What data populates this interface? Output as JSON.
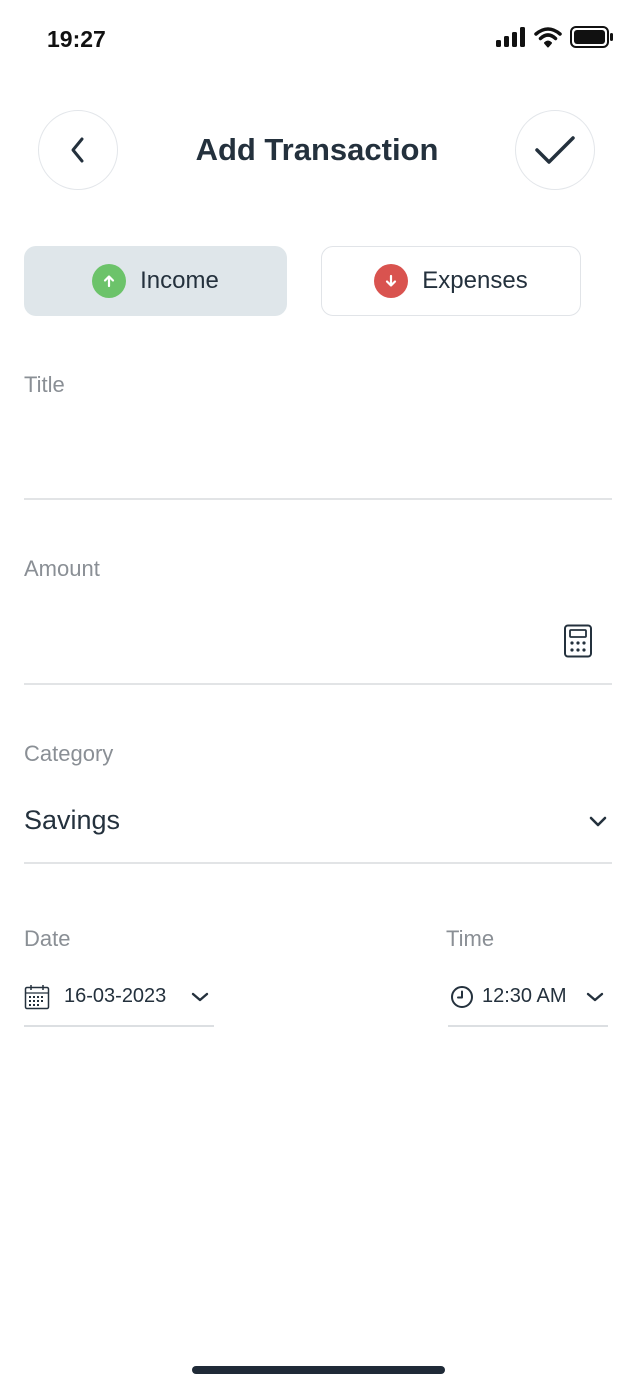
{
  "status_bar": {
    "time": "19:27"
  },
  "header": {
    "title": "Add Transaction"
  },
  "type_toggle": {
    "income_label": "Income",
    "expense_label": "Expenses",
    "income_color": "#6cc36a",
    "expense_color": "#d9534f",
    "selected": "Income"
  },
  "form": {
    "title": {
      "label": "Title",
      "value": ""
    },
    "amount": {
      "label": "Amount",
      "value": ""
    },
    "category": {
      "label": "Category",
      "value": "Savings"
    },
    "date": {
      "label": "Date",
      "value": "16-03-2023"
    },
    "time": {
      "label": "Time",
      "value": "12:30 AM"
    }
  },
  "icons": {
    "back": "chevron-left-icon",
    "confirm": "check-icon",
    "calculator": "calculator-icon",
    "calendar": "calendar-icon",
    "clock": "clock-icon",
    "dropdown": "chevron-down-icon"
  }
}
